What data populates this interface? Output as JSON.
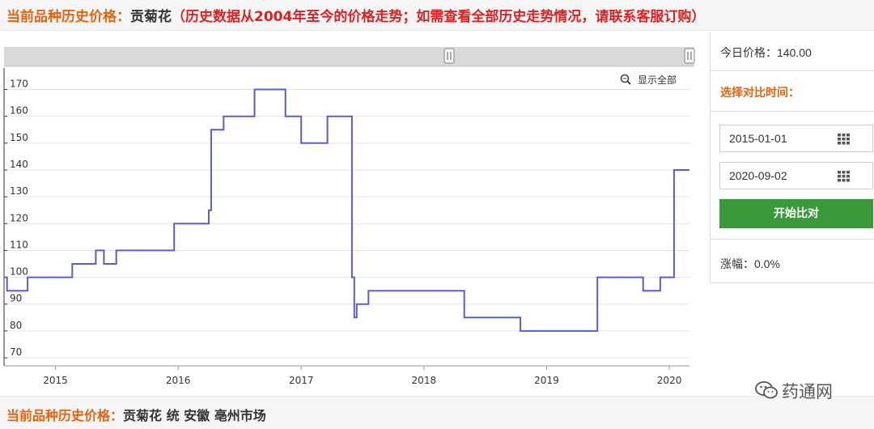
{
  "header": {
    "label": "当前品种历史价格：",
    "herb": "贡菊花",
    "note": "（历史数据从2004年至今的价格走势；如需查看全部历史走势情况，请联系客服订购）"
  },
  "chart": {
    "show_all_label": "显示全部",
    "icons": {
      "show_all": "zoom-icon",
      "slider_handle": "grip-handle-icon"
    }
  },
  "chart_data": {
    "type": "line",
    "step": true,
    "title": "",
    "xlabel": "",
    "ylabel": "",
    "ylim": [
      67,
      178
    ],
    "xlim": [
      "2014-08-01",
      "2020-03-01"
    ],
    "yticks": [
      70,
      80,
      90,
      100,
      110,
      120,
      130,
      140,
      150,
      160,
      170
    ],
    "xticks": [
      {
        "label": "2015",
        "date": "2015-01-01"
      },
      {
        "label": "2016",
        "date": "2016-01-01"
      },
      {
        "label": "2017",
        "date": "2017-01-01"
      },
      {
        "label": "2018",
        "date": "2018-01-01"
      },
      {
        "label": "2019",
        "date": "2019-01-01"
      },
      {
        "label": "2020",
        "date": "2020-01-01"
      }
    ],
    "grid": true,
    "color": "#5b5bd6",
    "series": [
      {
        "x": [
          "2014-08-01",
          "2014-08-10",
          "2014-10-10",
          "2015-02-20",
          "2015-05-01",
          "2015-05-25",
          "2015-07-01",
          "2015-12-20",
          "2016-04-01",
          "2016-04-08",
          "2016-05-15",
          "2016-07-01",
          "2016-08-15",
          "2016-11-15",
          "2017-01-01",
          "2017-03-20",
          "2017-06-01",
          "2017-06-08",
          "2017-06-15",
          "2017-07-01",
          "2017-07-20",
          "2017-08-25",
          "2018-01-01",
          "2018-05-01",
          "2018-10-15",
          "2019-01-01",
          "2019-06-01",
          "2019-10-15",
          "2019-12-05",
          "2020-01-15",
          "2020-01-25",
          "2020-03-01"
        ],
        "y": [
          100,
          95,
          100,
          105,
          110,
          105,
          110,
          120,
          125,
          155,
          160,
          160,
          170,
          160,
          150,
          160,
          100,
          85,
          90,
          90,
          95,
          95,
          95,
          85,
          80,
          80,
          100,
          95,
          100,
          140,
          140,
          140
        ]
      }
    ]
  },
  "sidebar": {
    "today_price": "今日价格：140.00",
    "compare_heading": "选择对比时间：",
    "start_date": "2015-01-01",
    "end_date": "2020-09-02",
    "compare_button": "开始比对",
    "change": "涨幅：0.0%"
  },
  "footer": {
    "label": "当前品种历史价格：",
    "info": "贡菊花 统 安徽 亳州市场"
  },
  "watermark": {
    "text": "药通网",
    "icon": "wechat-icon"
  },
  "colors": {
    "orange": "#e8620c",
    "red": "#e02020",
    "green": "#3a9a3a",
    "line": "#5b5bd6"
  }
}
